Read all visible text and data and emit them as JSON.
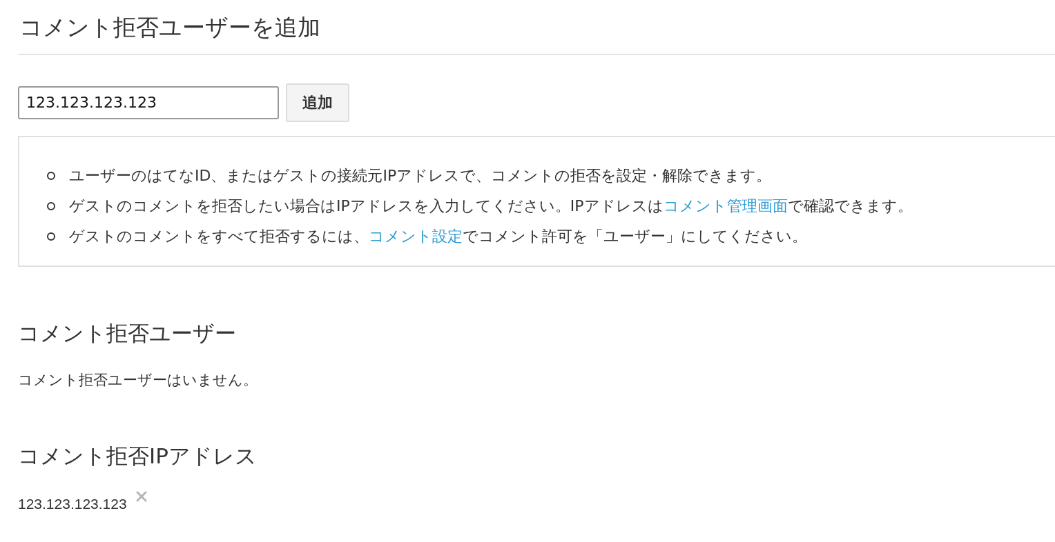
{
  "add_section": {
    "title": "コメント拒否ユーザーを追加",
    "input": {
      "value": "123.123.123.123"
    },
    "button": "追加"
  },
  "notes": [
    {
      "parts": [
        {
          "kind": "text",
          "text": "ユーザーのはてなID、またはゲストの接続元IPアドレスで、コメントの拒否を設定・解除できます。"
        }
      ]
    },
    {
      "parts": [
        {
          "kind": "text",
          "text": "ゲストのコメントを拒否したい場合はIPアドレスを入力してください。IPアドレスは"
        },
        {
          "kind": "link",
          "text": "コメント管理画面"
        },
        {
          "kind": "text",
          "text": "で確認できます。"
        }
      ]
    },
    {
      "parts": [
        {
          "kind": "text",
          "text": "ゲストのコメントをすべて拒否するには、"
        },
        {
          "kind": "link",
          "text": "コメント設定"
        },
        {
          "kind": "text",
          "text": "でコメント許可を「ユーザー」にしてください。"
        }
      ]
    }
  ],
  "blocked_users": {
    "title": "コメント拒否ユーザー",
    "empty_message": "コメント拒否ユーザーはいません。"
  },
  "blocked_ips": {
    "title": "コメント拒否IPアドレス",
    "items": [
      {
        "address": "123.123.123.123"
      }
    ]
  }
}
